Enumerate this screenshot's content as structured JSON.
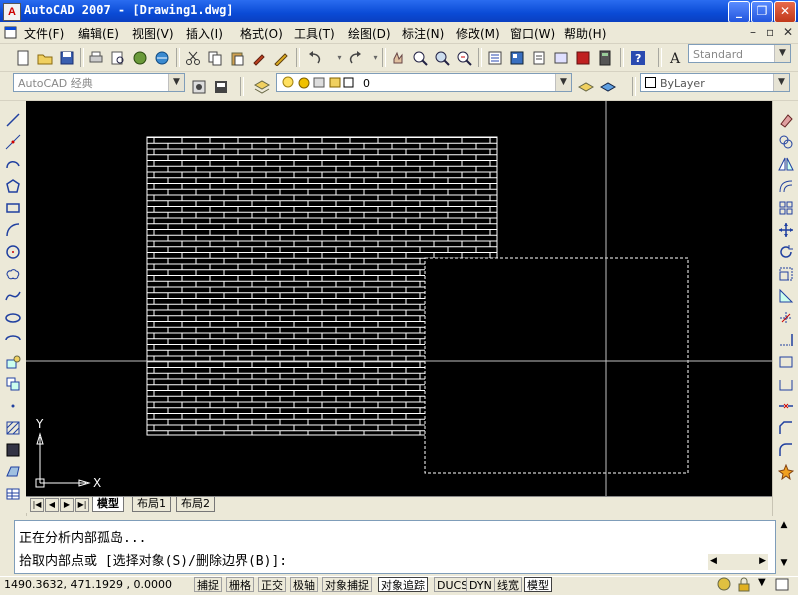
{
  "window": {
    "title": "AutoCAD 2007 - [Drawing1.dwg]",
    "app_icon_letter": "A"
  },
  "menu": {
    "items": [
      "文件(F)",
      "编辑(E)",
      "视图(V)",
      "插入(I)",
      "格式(O)",
      "工具(T)",
      "绘图(D)",
      "标注(N)",
      "修改(M)",
      "窗口(W)",
      "帮助(H)"
    ]
  },
  "toolbar": {
    "text_style": "Standard",
    "workspace": "AutoCAD 经典",
    "layer": "0",
    "color": "ByLayer"
  },
  "tabs": {
    "model": "模型",
    "layout1": "布局1",
    "layout2": "布局2"
  },
  "ucs": {
    "x_label": "X",
    "y_label": "Y"
  },
  "command": {
    "line1": "正在分析内部孤岛...",
    "line2": "拾取内部点或 [选择对象(S)/删除边界(B)]:"
  },
  "status": {
    "coords": "1490.3632, 471.1929 , 0.0000",
    "buttons": [
      {
        "label": "捕捉",
        "on": false
      },
      {
        "label": "栅格",
        "on": false
      },
      {
        "label": "正交",
        "on": false
      },
      {
        "label": "极轴",
        "on": false
      },
      {
        "label": "对象捕捉",
        "on": false
      },
      {
        "label": "对象追踪",
        "on": true
      },
      {
        "label": "DUCS",
        "on": false
      },
      {
        "label": "DYN",
        "on": false
      },
      {
        "label": "线宽",
        "on": false
      },
      {
        "label": "模型",
        "on": true
      }
    ]
  },
  "colors": {
    "canvas_bg": "#000000",
    "hatch": "#ffffff",
    "crosshair": "#c0c0c0",
    "title_bar": "#0a4bd6"
  }
}
